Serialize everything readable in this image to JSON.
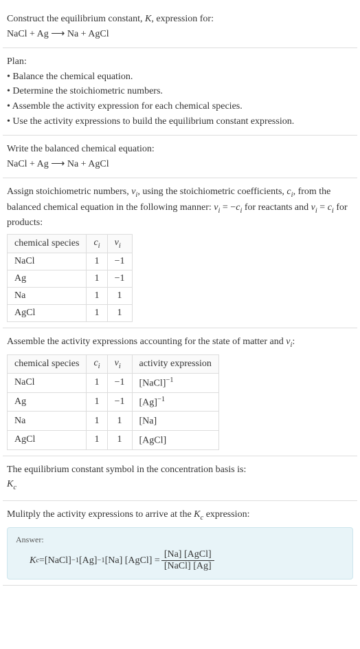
{
  "header": {
    "line1_prefix": "Construct the equilibrium constant, ",
    "line1_K": "K",
    "line1_suffix": ", expression for:",
    "equation": "NaCl + Ag ⟶ Na + AgCl"
  },
  "plan": {
    "title": "Plan:",
    "items": [
      "• Balance the chemical equation.",
      "• Determine the stoichiometric numbers.",
      "• Assemble the activity expression for each chemical species.",
      "• Use the activity expressions to build the equilibrium constant expression."
    ]
  },
  "balanced": {
    "title": "Write the balanced chemical equation:",
    "equation": "NaCl + Ag ⟶ Na + AgCl"
  },
  "stoich": {
    "intro_1": "Assign stoichiometric numbers, ",
    "nu": "ν",
    "nu_sub": "i",
    "intro_2": ", using the stoichiometric coefficients, ",
    "c": "c",
    "c_sub": "i",
    "intro_3": ", from the balanced chemical equation in the following manner: ",
    "rel1_lhs": "ν",
    "rel1_eq": " = −",
    "rel1_rhs": "c",
    "intro_4": " for reactants and ",
    "rel2_lhs": "ν",
    "rel2_eq": " = ",
    "rel2_rhs": "c",
    "intro_5": " for products:",
    "headers": {
      "species": "chemical species",
      "ci": "c",
      "ci_sub": "i",
      "vi": "ν",
      "vi_sub": "i"
    },
    "rows": [
      {
        "species": "NaCl",
        "c": "1",
        "v": "−1"
      },
      {
        "species": "Ag",
        "c": "1",
        "v": "−1"
      },
      {
        "species": "Na",
        "c": "1",
        "v": "1"
      },
      {
        "species": "AgCl",
        "c": "1",
        "v": "1"
      }
    ]
  },
  "activity": {
    "intro_1": "Assemble the activity expressions accounting for the state of matter and ",
    "nu": "ν",
    "nu_sub": "i",
    "intro_2": ":",
    "headers": {
      "species": "chemical species",
      "ci": "c",
      "ci_sub": "i",
      "vi": "ν",
      "vi_sub": "i",
      "act": "activity expression"
    },
    "rows": [
      {
        "species": "NaCl",
        "c": "1",
        "v": "−1",
        "expr_base": "[NaCl]",
        "expr_sup": "−1"
      },
      {
        "species": "Ag",
        "c": "1",
        "v": "−1",
        "expr_base": "[Ag]",
        "expr_sup": "−1"
      },
      {
        "species": "Na",
        "c": "1",
        "v": "1",
        "expr_base": "[Na]",
        "expr_sup": ""
      },
      {
        "species": "AgCl",
        "c": "1",
        "v": "1",
        "expr_base": "[AgCl]",
        "expr_sup": ""
      }
    ]
  },
  "symbol": {
    "line": "The equilibrium constant symbol in the concentration basis is:",
    "K": "K",
    "K_sub": "c"
  },
  "multiply": {
    "line_1": "Mulitply the activity expressions to arrive at the ",
    "K": "K",
    "K_sub": "c",
    "line_2": " expression:"
  },
  "answer": {
    "label": "Answer:",
    "Kc": "K",
    "Kc_sub": "c",
    "eq": " = ",
    "t1": "[NaCl]",
    "t1_sup": "−1",
    "t2": " [Ag]",
    "t2_sup": "−1",
    "t3": " [Na] [AgCl] = ",
    "num": "[Na] [AgCl]",
    "den": "[NaCl] [Ag]"
  },
  "chart_data": {
    "type": "table",
    "tables": [
      {
        "title": "Stoichiometric numbers",
        "columns": [
          "chemical species",
          "c_i",
          "ν_i"
        ],
        "rows": [
          [
            "NaCl",
            1,
            -1
          ],
          [
            "Ag",
            1,
            -1
          ],
          [
            "Na",
            1,
            1
          ],
          [
            "AgCl",
            1,
            1
          ]
        ]
      },
      {
        "title": "Activity expressions",
        "columns": [
          "chemical species",
          "c_i",
          "ν_i",
          "activity expression"
        ],
        "rows": [
          [
            "NaCl",
            1,
            -1,
            "[NaCl]^-1"
          ],
          [
            "Ag",
            1,
            -1,
            "[Ag]^-1"
          ],
          [
            "Na",
            1,
            1,
            "[Na]"
          ],
          [
            "AgCl",
            1,
            1,
            "[AgCl]"
          ]
        ]
      }
    ]
  }
}
